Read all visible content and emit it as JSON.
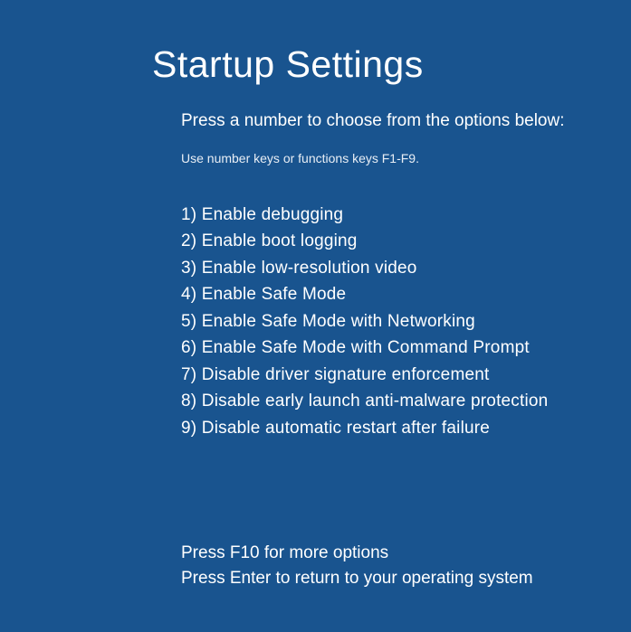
{
  "title": "Startup Settings",
  "instruction": "Press a number to choose from the options below:",
  "hint": "Use number keys or functions keys F1-F9.",
  "options": [
    {
      "num": "1",
      "label": "Enable debugging"
    },
    {
      "num": "2",
      "label": "Enable boot logging"
    },
    {
      "num": "3",
      "label": "Enable low-resolution video"
    },
    {
      "num": "4",
      "label": "Enable Safe Mode"
    },
    {
      "num": "5",
      "label": "Enable Safe Mode with Networking"
    },
    {
      "num": "6",
      "label": "Enable Safe Mode with Command Prompt"
    },
    {
      "num": "7",
      "label": "Disable driver signature enforcement"
    },
    {
      "num": "8",
      "label": "Disable early launch anti-malware protection"
    },
    {
      "num": "9",
      "label": "Disable automatic restart after failure"
    }
  ],
  "footer": {
    "more": "Press F10 for more options",
    "return": "Press Enter to return to your operating system"
  }
}
